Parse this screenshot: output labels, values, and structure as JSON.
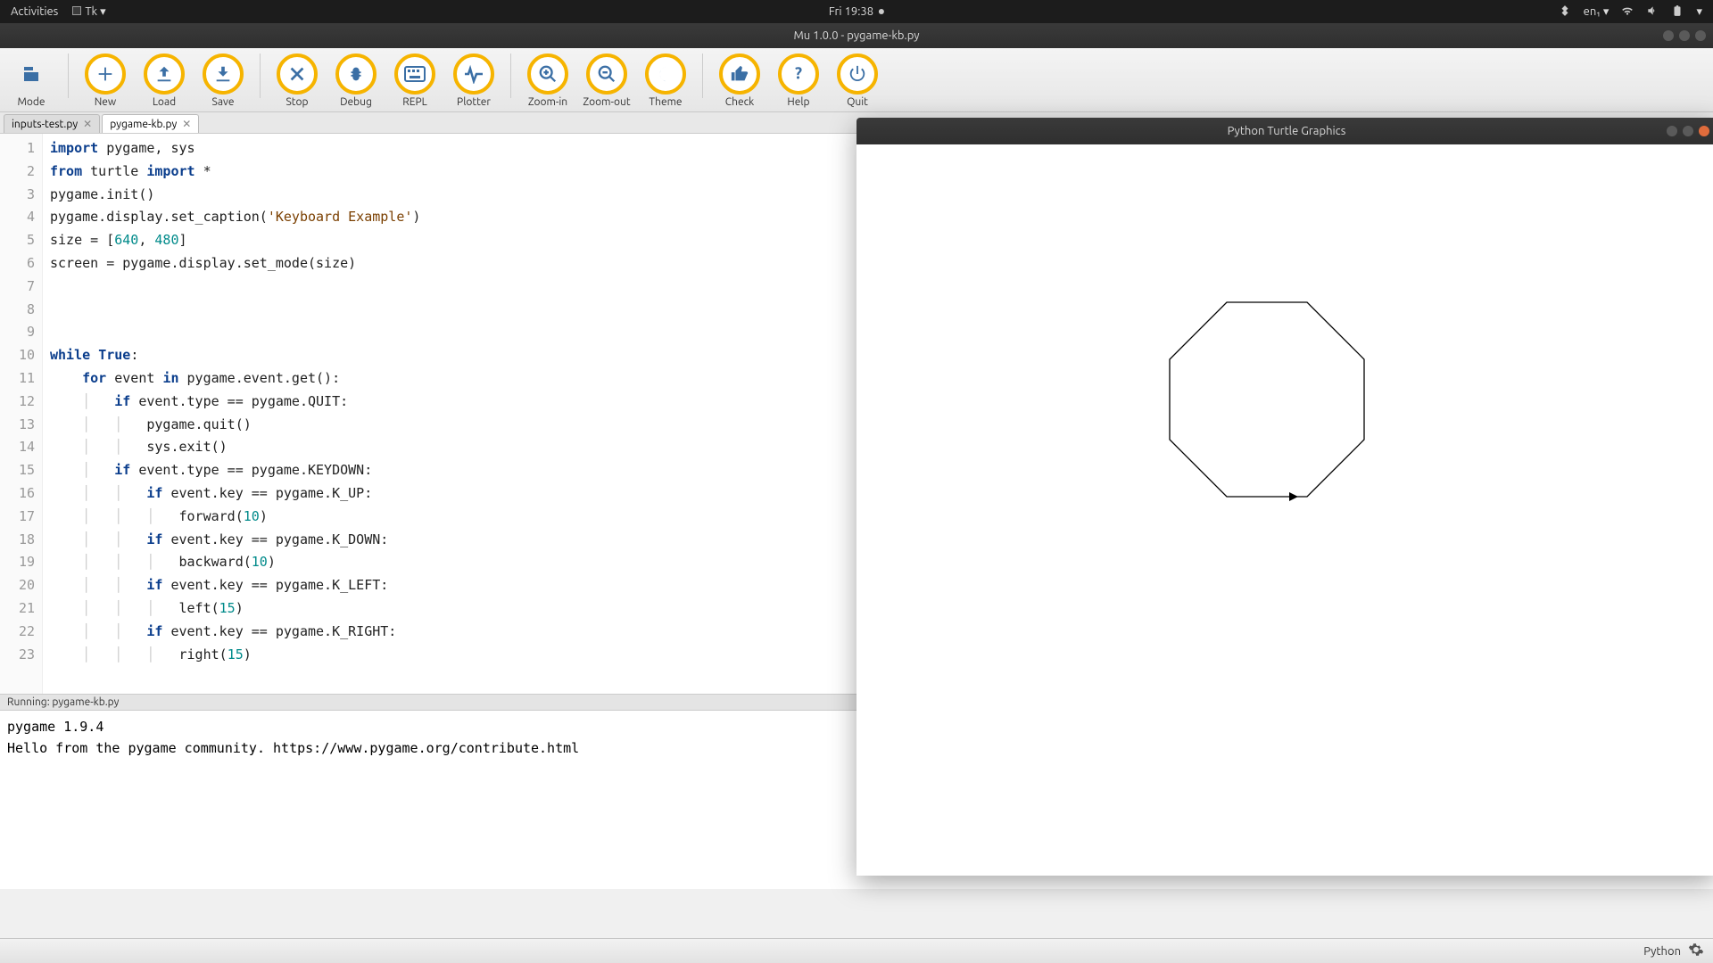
{
  "gnome": {
    "activities": "Activities",
    "app": "Tk",
    "clock": "Fri 19:38",
    "lang": "en₁"
  },
  "window": {
    "title": "Mu 1.0.0 - pygame-kb.py"
  },
  "toolbar": [
    {
      "label": "Mode",
      "icon": "mode"
    },
    {
      "label": "New",
      "icon": "plus"
    },
    {
      "label": "Load",
      "icon": "upload"
    },
    {
      "label": "Save",
      "icon": "download"
    },
    {
      "label": "Stop",
      "icon": "x"
    },
    {
      "label": "Debug",
      "icon": "bug"
    },
    {
      "label": "REPL",
      "icon": "keyboard"
    },
    {
      "label": "Plotter",
      "icon": "pulse"
    },
    {
      "label": "Zoom-in",
      "icon": "zoomin"
    },
    {
      "label": "Zoom-out",
      "icon": "zoomout"
    },
    {
      "label": "Theme",
      "icon": "moon"
    },
    {
      "label": "Check",
      "icon": "thumb"
    },
    {
      "label": "Help",
      "icon": "help"
    },
    {
      "label": "Quit",
      "icon": "power"
    }
  ],
  "tabs": [
    {
      "name": "inputs-test.py",
      "active": false
    },
    {
      "name": "pygame-kb.py",
      "active": true
    }
  ],
  "code_lines": [
    {
      "n": 1,
      "html": "<span class=kw>import</span> pygame, sys"
    },
    {
      "n": 2,
      "html": "<span class=kw>from</span> turtle <span class=kw>import</span> *"
    },
    {
      "n": 3,
      "html": "pygame.init()"
    },
    {
      "n": 4,
      "html": "pygame.display.set_caption(<span class=str>'Keyboard Example'</span>)"
    },
    {
      "n": 5,
      "html": "size = [<span class=num>640</span>, <span class=num>480</span>]"
    },
    {
      "n": 6,
      "html": "screen = pygame.display.set_mode(size)"
    },
    {
      "n": 7,
      "html": ""
    },
    {
      "n": 8,
      "html": ""
    },
    {
      "n": 9,
      "html": ""
    },
    {
      "n": 10,
      "html": "<span class=kw>while</span> <span class=kw>True</span>:"
    },
    {
      "n": 11,
      "html": "    <span class=kw>for</span> event <span class=kw>in</span> pygame.event.get():"
    },
    {
      "n": 12,
      "html": "    <span class=guide>│</span>   <span class=kw>if</span> event.type == pygame.QUIT:"
    },
    {
      "n": 13,
      "html": "    <span class=guide>│</span>   <span class=guide>│</span>   pygame.quit()"
    },
    {
      "n": 14,
      "html": "    <span class=guide>│</span>   <span class=guide>│</span>   sys.exit()"
    },
    {
      "n": 15,
      "html": "    <span class=guide>│</span>   <span class=kw>if</span> event.type == pygame.KEYDOWN:"
    },
    {
      "n": 16,
      "html": "    <span class=guide>│</span>   <span class=guide>│</span>   <span class=kw>if</span> event.key == pygame.K_UP:"
    },
    {
      "n": 17,
      "html": "    <span class=guide>│</span>   <span class=guide>│</span>   <span class=guide>│</span>   forward(<span class=num>10</span>)"
    },
    {
      "n": 18,
      "html": "    <span class=guide>│</span>   <span class=guide>│</span>   <span class=kw>if</span> event.key == pygame.K_DOWN:"
    },
    {
      "n": 19,
      "html": "    <span class=guide>│</span>   <span class=guide>│</span>   <span class=guide>│</span>   backward(<span class=num>10</span>)"
    },
    {
      "n": 20,
      "html": "    <span class=guide>│</span>   <span class=guide>│</span>   <span class=kw>if</span> event.key == pygame.K_LEFT:"
    },
    {
      "n": 21,
      "html": "    <span class=guide>│</span>   <span class=guide>│</span>   <span class=guide>│</span>   left(<span class=num>15</span>)"
    },
    {
      "n": 22,
      "html": "    <span class=guide>│</span>   <span class=guide>│</span>   <span class=kw>if</span> event.key == pygame.K_RIGHT:"
    },
    {
      "n": 23,
      "html": "    <span class=guide>│</span>   <span class=guide>│</span>   <span class=guide>│</span>   right(<span class=num>15</span>)"
    }
  ],
  "status_running": "Running: pygame-kb.py",
  "console": [
    "pygame 1.9.4",
    "Hello from the pygame community. https://www.pygame.org/contribute.html"
  ],
  "footer": {
    "lang": "Python"
  },
  "turtle": {
    "title": "Python Turtle Graphics"
  }
}
